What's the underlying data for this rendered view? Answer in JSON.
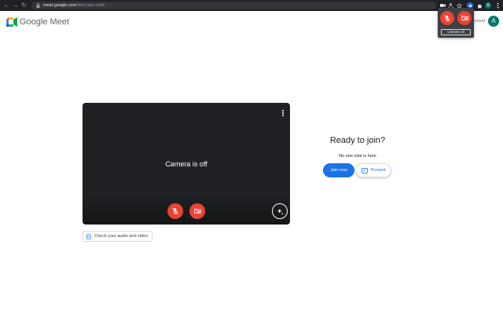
{
  "browser": {
    "url_host": "meet.google.com",
    "url_path": "/dch-cqez-unih",
    "nav": {
      "back": "←",
      "forward": "→",
      "reload": "↻"
    },
    "avatar_letter": "A"
  },
  "header": {
    "brand": "Google Meet",
    "account_text": "ccount",
    "avatar_letter": "A"
  },
  "popup": {
    "unmute_all_label": "Unmute all"
  },
  "preview": {
    "camera_off_text": "Camera is off"
  },
  "check_audio_video_label": "Check your audio and video",
  "join_panel": {
    "title": "Ready to join?",
    "subtitle": "No one else is here",
    "join_label": "Join now",
    "present_label": "Present"
  },
  "colors": {
    "accent_blue": "#1a73e8",
    "mute_red": "#ea4335",
    "preview_bg": "#202124",
    "chrome_bg": "#202124"
  }
}
